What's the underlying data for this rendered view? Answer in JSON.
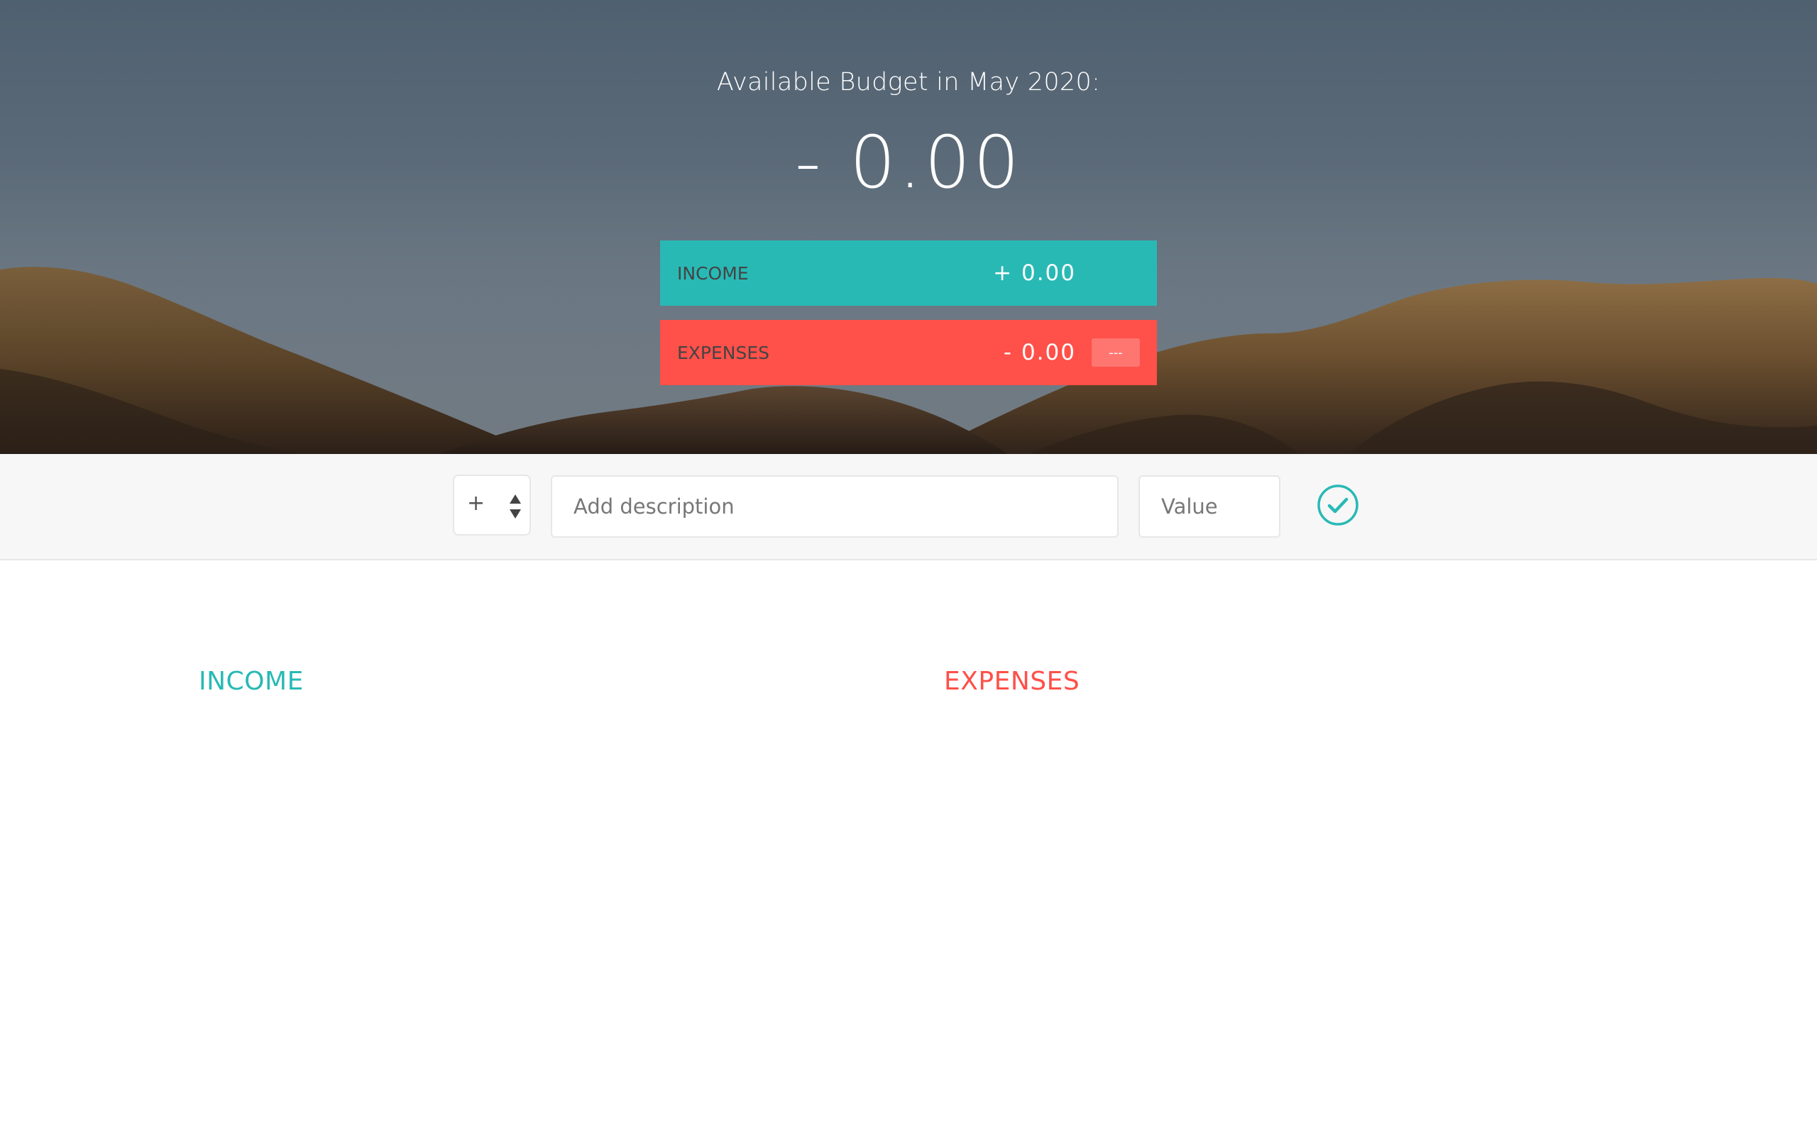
{
  "budget": {
    "title": "Available Budget in May 2020:",
    "value": "- 0.00",
    "income": {
      "label": "INCOME",
      "value": "+ 0.00"
    },
    "expenses": {
      "label": "EXPENSES",
      "value": "- 0.00",
      "percentage": "---"
    }
  },
  "add": {
    "type_value": "+",
    "description_placeholder": "Add description",
    "value_placeholder": "Value",
    "submit_icon": "check-circle-icon"
  },
  "lists": {
    "income_title": "INCOME",
    "expenses_title": "EXPENSES"
  },
  "colors": {
    "income": "#28b9b5",
    "expenses": "#ff5049"
  }
}
